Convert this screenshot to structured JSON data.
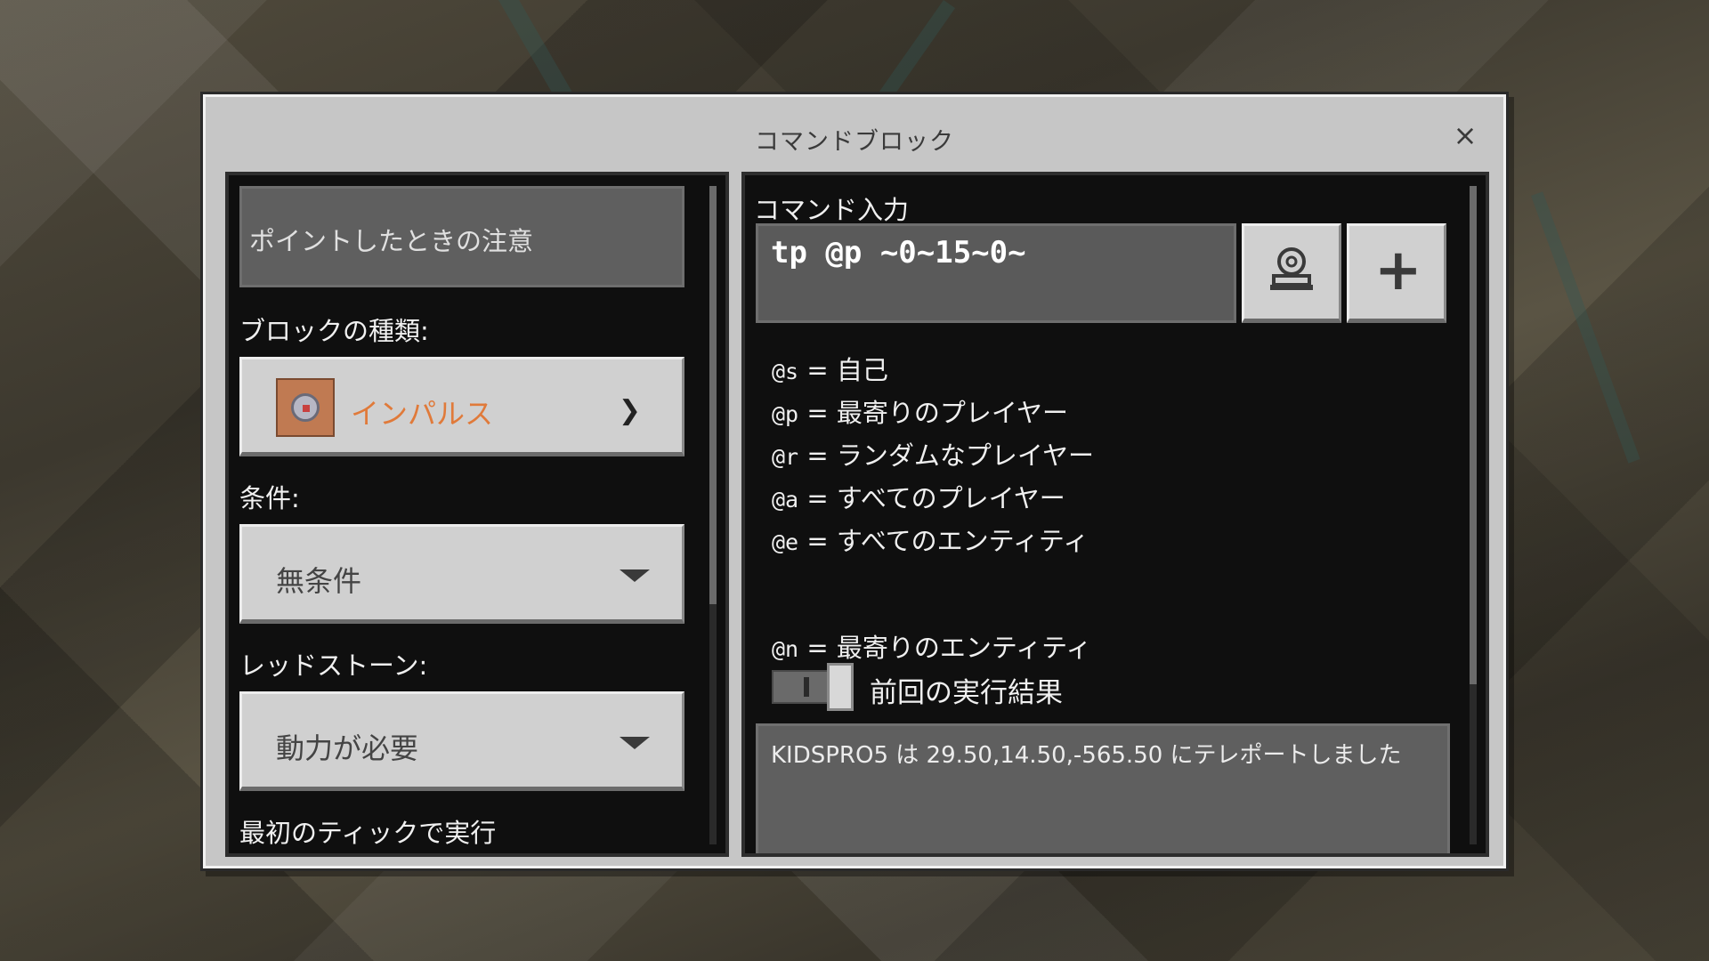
{
  "dialog": {
    "title": "コマンドブロック",
    "close_icon": "×"
  },
  "left": {
    "hover_note_placeholder": "ポイントしたときの注意",
    "block_type_label": "ブロックの種類:",
    "block_type_value": "インパルス",
    "block_type_color": "#e07a3a",
    "condition_label": "条件:",
    "condition_value": "無条件",
    "redstone_label": "レッドストーン:",
    "redstone_value": "動力が必要",
    "first_tick_label": "最初のティックで実行"
  },
  "right": {
    "command_label": "コマンド入力",
    "command_value": "tp @p ~0~15~0~",
    "selectors": [
      {
        "key": "@s",
        "desc": "自己"
      },
      {
        "key": "@p",
        "desc": "最寄りのプレイヤー"
      },
      {
        "key": "@r",
        "desc": "ランダムなプレイヤー"
      },
      {
        "key": "@a",
        "desc": "すべてのプレイヤー"
      },
      {
        "key": "@e",
        "desc": "すべてのエンティティ"
      },
      {
        "key": "@n",
        "desc": "最寄りのエンティティ"
      }
    ],
    "equals": "=",
    "previous_output_label": "前回の実行結果",
    "previous_output_toggle_on": true,
    "output_text": "KIDSPRO5 は 29.50,14.50,-565.50 にテレポートしました",
    "add_button_icon": "plus-icon",
    "pick_button_icon": "selector-icon"
  }
}
